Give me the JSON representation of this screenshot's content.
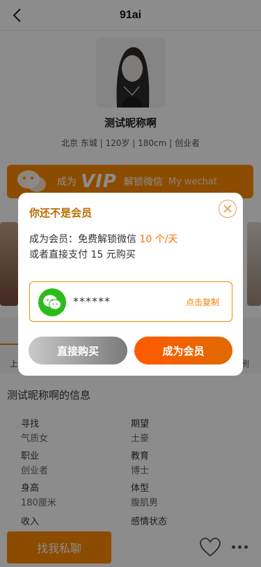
{
  "app": {
    "title": "91ai"
  },
  "profile": {
    "nickname": "测试昵称啊",
    "subinfo": "北京 东城 | 120岁 | 180cm | 创业者"
  },
  "vip_banner": {
    "prefix": "成为",
    "vip": "VIP",
    "action": "解锁微信",
    "suffix": "My wechat"
  },
  "tabs": {
    "left": "上",
    "right": "刷"
  },
  "info_section": {
    "title": "测试昵称啊的信息",
    "items": [
      {
        "k": "寻找",
        "v": "气质女"
      },
      {
        "k": "期望",
        "v": "土豪"
      },
      {
        "k": "职业",
        "v": "创业者"
      },
      {
        "k": "教育",
        "v": "博士"
      },
      {
        "k": "身高",
        "v": "180厘米"
      },
      {
        "k": "体型",
        "v": "腹肌男"
      },
      {
        "k": "收入",
        "v": ""
      },
      {
        "k": "感情状态",
        "v": ""
      }
    ]
  },
  "bottom": {
    "chat_label": "找我私聊"
  },
  "modal": {
    "heading": "你还不是会员",
    "line1_prefix": "成为会员：免费解锁微信 ",
    "line1_highlight": "10 个/天",
    "line2": "或者直接支付 15 元购买",
    "wechat_masked": "******",
    "copy_label": "点击复制",
    "buy_label": "直接购买",
    "member_label": "成为会员"
  },
  "icons": {
    "back": "chevron-left-icon",
    "close": "close-circle-icon",
    "wechat": "wechat-icon",
    "heart": "heart-icon",
    "more": "more-dots-icon"
  },
  "colors": {
    "accent": "#ff8a00",
    "highlight": "#ff6a00",
    "heading": "#b86b00",
    "wechat": "#2bbc1a"
  }
}
